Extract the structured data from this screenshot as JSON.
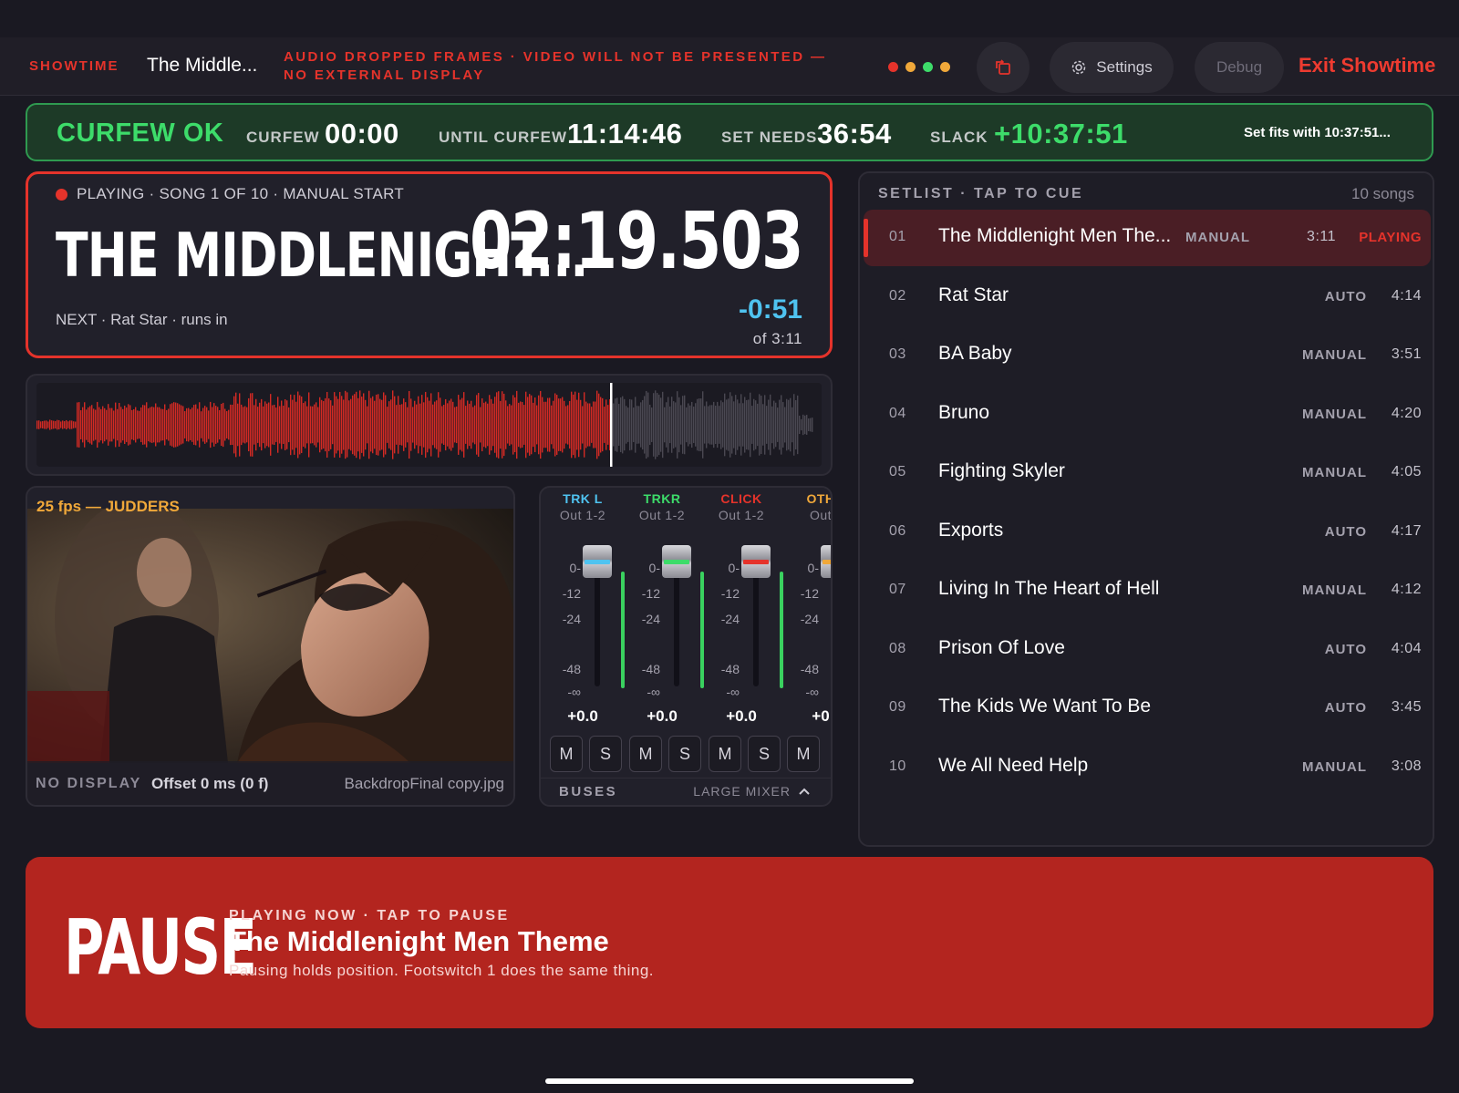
{
  "topbar": {
    "brand": "SHOWTIME",
    "song_short": "The Middle...",
    "warning": "AUDIO DROPPED FRAMES · VIDEO WILL NOT BE PRESENTED — NO EXTERNAL DISPLAY",
    "status_dots": [
      "#e5332b",
      "#f0a83a",
      "#3ddc6a",
      "#f0a83a"
    ],
    "settings_label": "Settings",
    "debug_label": "Debug",
    "exit_label": "Exit Showtime"
  },
  "curfew": {
    "status": "CURFEW OK",
    "curfew_label": "CURFEW",
    "curfew_value": "00:00",
    "until_label": "UNTIL CURFEW",
    "until_value": "11:14:46",
    "needs_label": "SET NEEDS",
    "needs_value": "36:54",
    "slack_label": "SLACK",
    "slack_value": "+10:37:51",
    "note": "Set fits with 10:37:51..."
  },
  "now": {
    "status": "PLAYING · SONG 1 OF 10 · MANUAL START",
    "title": "THE MIDDLENIGHT...",
    "elapsed": "02:19.503",
    "next": "NEXT · Rat Star · runs in",
    "remaining": "-0:51",
    "of_total": "of 3:11",
    "progress": 0.73
  },
  "video": {
    "fps_warning": "25 fps — JUDDERS",
    "no_display": "NO DISPLAY",
    "offset": "Offset 0 ms (0 f)",
    "file": "BackdropFinal copy.jpg"
  },
  "mixer": {
    "scale": [
      "0-",
      "-12",
      "-24",
      "-48",
      "-∞"
    ],
    "channels": [
      {
        "name": "TRK L",
        "out": "Out 1-2",
        "gain": "+0.0",
        "color": "#4fc3f0"
      },
      {
        "name": "TRKR",
        "out": "Out 1-2",
        "gain": "+0.0",
        "color": "#3ddc6a"
      },
      {
        "name": "CLICK",
        "out": "Out 1-2",
        "gain": "+0.0",
        "color": "#e5332b"
      },
      {
        "name": "OTH",
        "out": "Out",
        "gain": "+0",
        "color": "#f0a83a"
      }
    ],
    "mute_label": "M",
    "solo_label": "S",
    "buses_label": "BUSES",
    "large_label": "LARGE MIXER"
  },
  "setlist": {
    "header": "SETLIST · TAP TO CUE",
    "count": "10 songs",
    "songs": [
      {
        "num": "01",
        "title": "The Middlenight Men The...",
        "mode": "MANUAL",
        "dur": "3:11",
        "state": "PLAYING"
      },
      {
        "num": "02",
        "title": "Rat Star",
        "mode": "AUTO",
        "dur": "4:14",
        "state": ""
      },
      {
        "num": "03",
        "title": "BA Baby",
        "mode": "MANUAL",
        "dur": "3:51",
        "state": ""
      },
      {
        "num": "04",
        "title": "Bruno",
        "mode": "MANUAL",
        "dur": "4:20",
        "state": ""
      },
      {
        "num": "05",
        "title": "Fighting Skyler",
        "mode": "MANUAL",
        "dur": "4:05",
        "state": ""
      },
      {
        "num": "06",
        "title": "Exports",
        "mode": "AUTO",
        "dur": "4:17",
        "state": ""
      },
      {
        "num": "07",
        "title": "Living In The Heart of Hell",
        "mode": "MANUAL",
        "dur": "4:12",
        "state": ""
      },
      {
        "num": "08",
        "title": "Prison Of Love",
        "mode": "AUTO",
        "dur": "4:04",
        "state": ""
      },
      {
        "num": "09",
        "title": "The Kids We Want To Be",
        "mode": "AUTO",
        "dur": "3:45",
        "state": ""
      },
      {
        "num": "10",
        "title": "We All Need Help",
        "mode": "MANUAL",
        "dur": "3:08",
        "state": ""
      }
    ]
  },
  "pause": {
    "label": "PAUSE",
    "sub": "PLAYING NOW · TAP TO PAUSE",
    "title": "The Middlenight Men Theme",
    "help": "Pausing holds position. Footswitch 1 does the same thing."
  }
}
